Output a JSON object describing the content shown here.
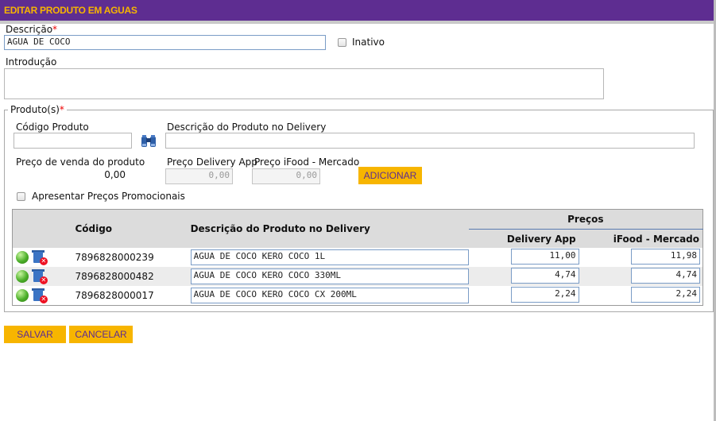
{
  "window": {
    "title": "EDITAR PRODUTO EM AGUAS"
  },
  "form": {
    "descricao_label": "Descrição",
    "descricao_value": "AGUA DE COCO",
    "inativo_label": "Inativo",
    "introducao_label": "Introdução",
    "introducao_value": ""
  },
  "produtos": {
    "legend": "Produto(s)",
    "codigo_label": "Código Produto",
    "codigo_value": "",
    "descricao_delivery_label": "Descrição do Produto no Delivery",
    "descricao_delivery_value": "",
    "preco_venda_label": "Preço de venda do produto",
    "preco_venda_value": "0,00",
    "preco_delivery_label": "Preço Delivery App",
    "preco_delivery_value": "0,00",
    "preco_ifood_label": "Preço iFood - Mercado",
    "preco_ifood_value": "0,00",
    "adicionar_label": "ADICIONAR",
    "promo_label": "Apresentar Preços Promocionais"
  },
  "table": {
    "col_codigo": "Código",
    "col_descricao": "Descrição do Produto no Delivery",
    "col_precos": "Preços",
    "col_delivery": "Delivery App",
    "col_ifood": "iFood - Mercado",
    "rows": [
      {
        "codigo": "7896828000239",
        "descricao": "AGUA DE COCO KERO COCO 1L",
        "delivery": "11,00",
        "ifood": "11,98"
      },
      {
        "codigo": "7896828000482",
        "descricao": "AGUA DE COCO KERO COCO 330ML",
        "delivery": "4,74",
        "ifood": "4,74"
      },
      {
        "codigo": "7896828000017",
        "descricao": "AGUA DE COCO KERO COCO CX 200ML",
        "delivery": "2,24",
        "ifood": "2,24"
      }
    ]
  },
  "actions": {
    "salvar_label": "SALVAR",
    "cancelar_label": "CANCELAR"
  },
  "colors": {
    "header_bg": "#5e2d91",
    "header_text": "#f7b500",
    "button_bg": "#f7b500",
    "button_text": "#5e2d91"
  }
}
